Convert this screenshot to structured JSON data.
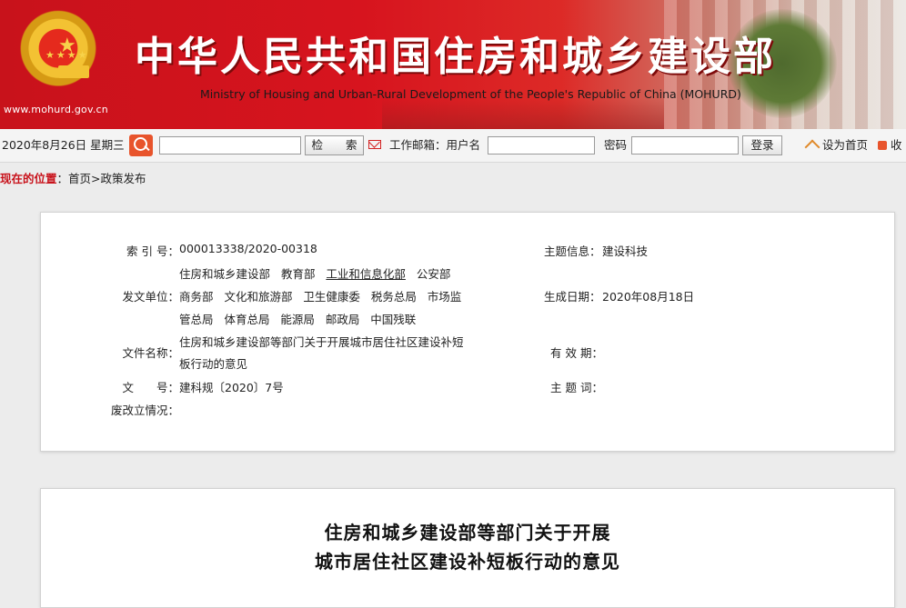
{
  "banner": {
    "site_url": "www.mohurd.gov.cn",
    "title_cn": "中华人民共和国住房和城乡建设部",
    "title_en": "Ministry of Housing and Urban-Rural Development of the People's Republic of China (MOHURD)",
    "emblem_icon": "national-emblem",
    "colors": {
      "primary": "#c8121b",
      "title_text": "#ffffff"
    }
  },
  "toolbar": {
    "date": "2020年8月26日 星期三",
    "search_value": "",
    "search_button": "检　　索",
    "mail_label": "工作邮箱：用户名",
    "username_value": "",
    "password_label": "密码",
    "password_value": "",
    "login_button": "登录",
    "set_home": "设为首页",
    "favorite": "收"
  },
  "breadcrumb": {
    "label": "现在的位置",
    "sep": "：",
    "path": "首页>政策发布"
  },
  "meta": {
    "index_label": "索 引 号：",
    "index_value": "000013338/2020-00318",
    "issuer_label": "发文单位：",
    "issuer_lines": [
      [
        "住房和城乡建设部",
        "教育部",
        "工业和信息化部",
        "公安部"
      ],
      [
        "商务部",
        "文化和旅游部",
        "卫生健康委",
        "税务总局",
        "市场监"
      ],
      [
        "管总局",
        "体育总局",
        "能源局",
        "邮政局",
        "中国残联"
      ]
    ],
    "doc_name_label": "文件名称：",
    "doc_name_lines": [
      "住房和城乡建设部等部门关于开展城市居住社区建设补短",
      "板行动的意见"
    ],
    "doc_no_label": "文　　号：",
    "doc_no_value": "建科规〔2020〕7号",
    "revision_label": "废改立情况：",
    "revision_value": "",
    "topic_label": "主题信息：",
    "topic_value": "建设科技",
    "date_label": "生成日期：",
    "date_value": "2020年08月18日",
    "validity_label": "有 效 期：",
    "validity_value": "",
    "keywords_label": "主 题 词：",
    "keywords_value": ""
  },
  "article": {
    "title_line1": "住房和城乡建设部等部门关于开展",
    "title_line2": "城市居住社区建设补短板行动的意见"
  }
}
